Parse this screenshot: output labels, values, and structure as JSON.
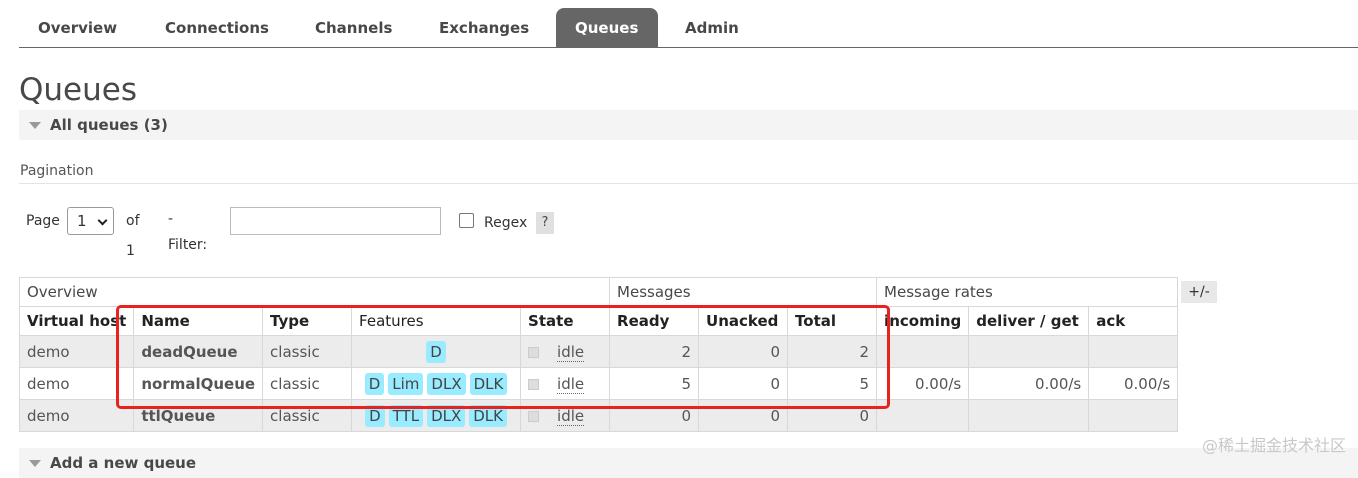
{
  "nav": {
    "tabs": [
      {
        "label": "Overview",
        "active": false
      },
      {
        "label": "Connections",
        "active": false
      },
      {
        "label": "Channels",
        "active": false
      },
      {
        "label": "Exchanges",
        "active": false
      },
      {
        "label": "Queues",
        "active": true
      },
      {
        "label": "Admin",
        "active": false
      }
    ]
  },
  "page_title": "Queues",
  "all_queues_label": "All queues (3)",
  "pagination": {
    "heading": "Pagination",
    "page_label": "Page",
    "page_value": "1",
    "of_label": "of 1",
    "filter_label": "- Filter:",
    "filter_value": "",
    "regex_label": "Regex",
    "help_label": "?"
  },
  "table": {
    "groups": {
      "overview": "Overview",
      "messages": "Messages",
      "rates": "Message rates"
    },
    "columns": {
      "vhost": "Virtual host",
      "name": "Name",
      "type": "Type",
      "features": "Features",
      "state": "State",
      "ready": "Ready",
      "unacked": "Unacked",
      "total": "Total",
      "incoming": "incoming",
      "deliver": "deliver / get",
      "ack": "ack"
    },
    "plus_minus": "+/-",
    "rows": [
      {
        "vhost": "demo",
        "name": "deadQueue",
        "type": "classic",
        "features": [
          "D"
        ],
        "state": "idle",
        "ready": "2",
        "unacked": "0",
        "total": "2",
        "incoming": "",
        "deliver": "",
        "ack": ""
      },
      {
        "vhost": "demo",
        "name": "normalQueue",
        "type": "classic",
        "features": [
          "D",
          "Lim",
          "DLX",
          "DLK"
        ],
        "state": "idle",
        "ready": "5",
        "unacked": "0",
        "total": "5",
        "incoming": "0.00/s",
        "deliver": "0.00/s",
        "ack": "0.00/s"
      },
      {
        "vhost": "demo",
        "name": "ttlQueue",
        "type": "classic",
        "features": [
          "D",
          "TTL",
          "DLX",
          "DLK"
        ],
        "state": "idle",
        "ready": "0",
        "unacked": "0",
        "total": "0",
        "incoming": "",
        "deliver": "",
        "ack": ""
      }
    ]
  },
  "add_queue_label": "Add a new queue",
  "watermark": "@稀土掘金技术社区",
  "colors": {
    "active_tab": "#666666",
    "badge": "#99ebff",
    "highlight": "#e8231f"
  }
}
